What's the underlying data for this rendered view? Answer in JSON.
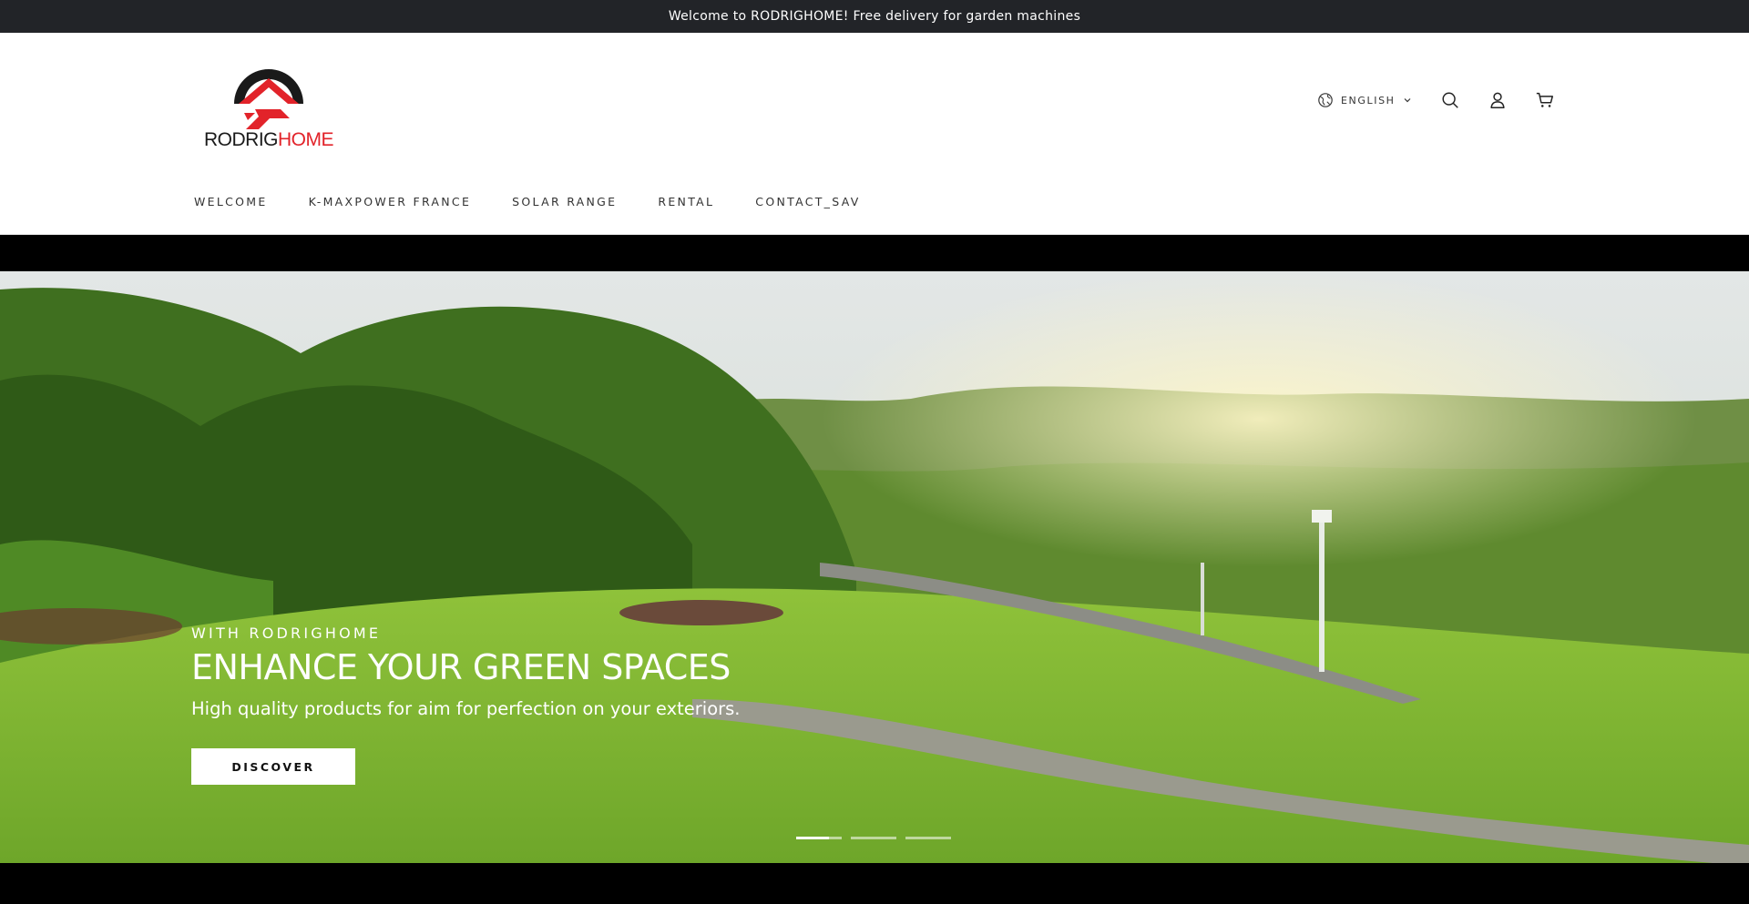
{
  "announcement": {
    "text": "Welcome to RODRIGHOME! Free delivery for garden machines"
  },
  "brand": {
    "name_part1": "RODRIG",
    "name_part2": "HOME",
    "accent_color": "#e2232a",
    "dark_color": "#1a1a1a"
  },
  "header": {
    "language": {
      "label": "ENGLISH",
      "icon": "globe-icon"
    },
    "icons": [
      "search-icon",
      "account-icon",
      "cart-icon"
    ]
  },
  "nav": {
    "items": [
      {
        "label": "WELCOME"
      },
      {
        "label": "K-MAXPOWER FRANCE"
      },
      {
        "label": "SOLAR RANGE"
      },
      {
        "label": "RENTAL"
      },
      {
        "label": "CONTACT_SAV"
      }
    ]
  },
  "hero": {
    "eyebrow": "WITH RODRIGHOME",
    "title": "ENHANCE YOUR GREEN SPACES",
    "subtitle": "High quality products for aim for perfection on your exteriors.",
    "button_label": "DISCOVER",
    "slides_total": 3,
    "active_slide": 1
  }
}
